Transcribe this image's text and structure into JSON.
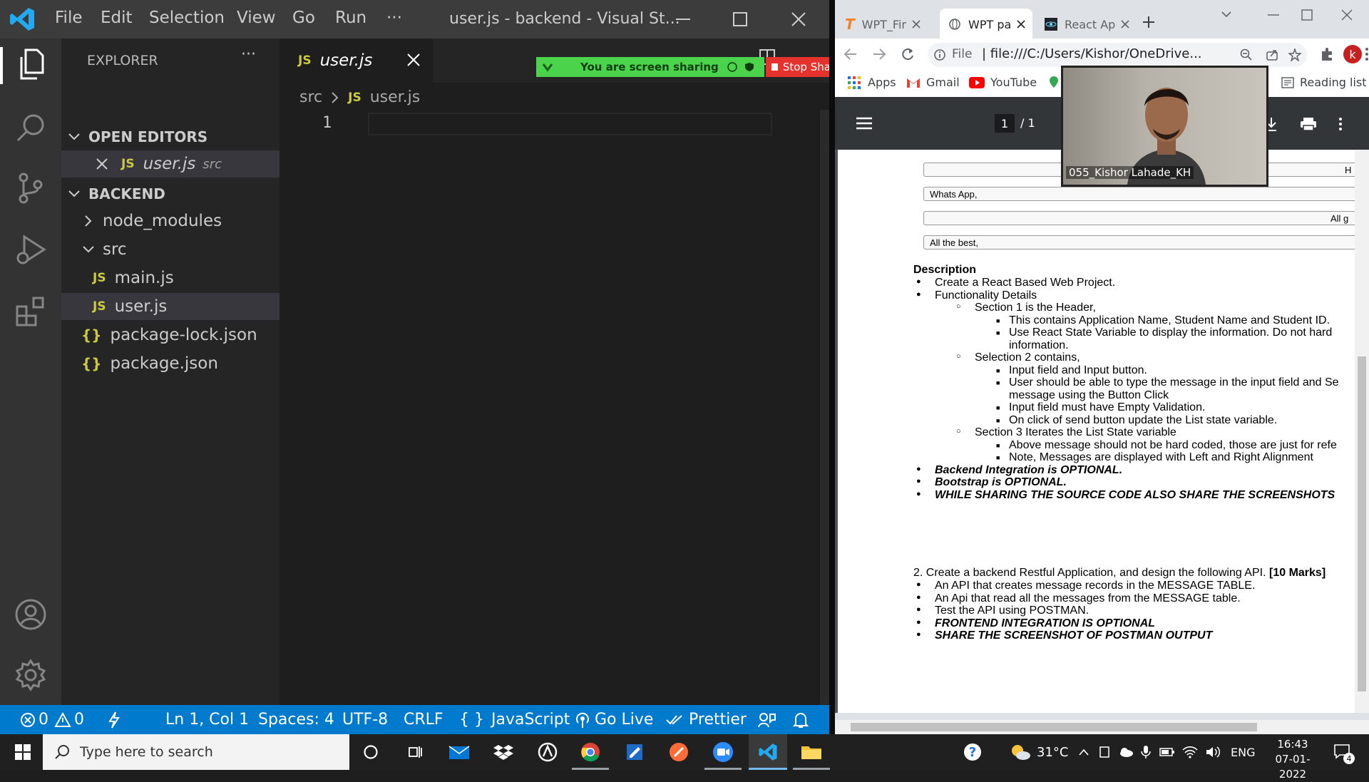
{
  "vscode": {
    "menu": [
      "File",
      "Edit",
      "Selection",
      "View",
      "Go",
      "Run",
      "···"
    ],
    "window_title": "user.js - backend - Visual St...",
    "explorer_title": "EXPLORER",
    "explorer_more": "···",
    "open_editors_header": "OPEN EDITORS",
    "open_editor_item": {
      "name": "user.js",
      "path": "src"
    },
    "project_header": "BACKEND",
    "tree": [
      {
        "label": "node_modules"
      },
      {
        "label": "src"
      },
      {
        "label": "main.js"
      },
      {
        "label": "user.js"
      },
      {
        "label": "package-lock.json"
      },
      {
        "label": "package.json"
      }
    ],
    "js_badge": "JS",
    "json_badge": "{}",
    "active_tab": "user.js",
    "breadcrumb": {
      "folder": "src",
      "file": "user.js"
    },
    "line_number": "1",
    "statusbar": {
      "errors": "0",
      "warnings": "0",
      "position": "Ln 1, Col 1",
      "spaces": "Spaces: 4",
      "encoding": "UTF-8",
      "eol": "CRLF",
      "language": "JavaScript",
      "go_live": "Go Live",
      "prettier": "Prettier"
    },
    "colors": {
      "accent": "#007acc",
      "js_yellow": "#cbcb41"
    }
  },
  "screen_share": {
    "message": "You are screen sharing",
    "stop_label": "Stop Share"
  },
  "chrome": {
    "tabs": [
      {
        "label": "WPT_Fir"
      },
      {
        "label": "WPT pa"
      },
      {
        "label": "React Ap"
      }
    ],
    "url_prefix": "File",
    "url": "file:///C:/Users/Kishor/OneDrive...",
    "profile_initial": "k",
    "bookmarks": [
      "Apps",
      "Gmail",
      "YouTube"
    ],
    "reading_list": "Reading list",
    "pdf_page_current": "1",
    "pdf_page_total": "/ 1"
  },
  "zoom": {
    "participant_name": "055_Kishor Lahade_KH"
  },
  "pdf": {
    "box_rows": [
      {
        "text": "",
        "right": "H"
      },
      {
        "text": "Whats App,",
        "right": ""
      },
      {
        "text": "",
        "right": "All g"
      },
      {
        "text": "All the best,",
        "right": ""
      }
    ],
    "description_heading": "Description",
    "lines": [
      {
        "level": 1,
        "text": "Create a React Based Web Project.",
        "style": "normal"
      },
      {
        "level": 1,
        "text": "Functionality Details",
        "style": "normal"
      },
      {
        "level": 2,
        "text": "Section 1 is the Header,",
        "style": "normal"
      },
      {
        "level": 3,
        "text": "This contains Application Name, Student Name and Student ID.",
        "style": "normal"
      },
      {
        "level": 3,
        "text": "Use React State Variable to display the information. Do not hard",
        "style": "normal"
      },
      {
        "level": 0,
        "text": "information.",
        "style": "normal"
      },
      {
        "level": 2,
        "text": "Selection 2 contains,",
        "style": "normal"
      },
      {
        "level": 3,
        "text": "Input field and Input button.",
        "style": "normal"
      },
      {
        "level": 3,
        "text": "User should be able to type the message in the input field and Se",
        "style": "normal"
      },
      {
        "level": 0,
        "text": "message using the Button Click",
        "style": "normal"
      },
      {
        "level": 3,
        "text": "Input field must have Empty Validation.",
        "style": "normal"
      },
      {
        "level": 3,
        "text": "On click of send button update the List state variable.",
        "style": "normal"
      },
      {
        "level": 2,
        "text": "Section 3 Iterates the List State variable",
        "style": "normal"
      },
      {
        "level": 3,
        "text": "Above message should not be hard coded, those are just for refe",
        "style": "normal"
      },
      {
        "level": 3,
        "text": "Note, Messages are displayed with Left and Right Alignment",
        "style": "normal"
      },
      {
        "level": 1,
        "text": "Backend Integration is OPTIONAL.",
        "style": "bolditalic"
      },
      {
        "level": 1,
        "text": "Bootstrap is OPTIONAL.",
        "style": "bolditalic"
      },
      {
        "level": 1,
        "text": "WHILE SHARING THE SOURCE CODE ALSO SHARE THE SCREENSHOTS",
        "style": "bolditalic"
      }
    ],
    "q2_text": "2. Create a backend Restful Application, and design the following API.",
    "q2_marks": "[10 Marks]",
    "q2_lines": [
      {
        "text": "An API that creates message records in the MESSAGE TABLE.",
        "style": "normal"
      },
      {
        "text": "An Api that read all the messages from the MESSAGE table.",
        "style": "normal"
      },
      {
        "text": "Test the API using POSTMAN.",
        "style": "normal"
      },
      {
        "text": "FRONTEND INTEGRATION IS OPTIONAL",
        "style": "bolditalic"
      },
      {
        "text": "SHARE THE SCREENSHOT OF POSTMAN OUTPUT",
        "style": "bolditalic"
      }
    ]
  },
  "taskbar": {
    "search_placeholder": "Type here to search",
    "temperature": "31°C",
    "language": "ENG",
    "time": "16:43",
    "date": "07-01-2022",
    "notifications": "4"
  }
}
